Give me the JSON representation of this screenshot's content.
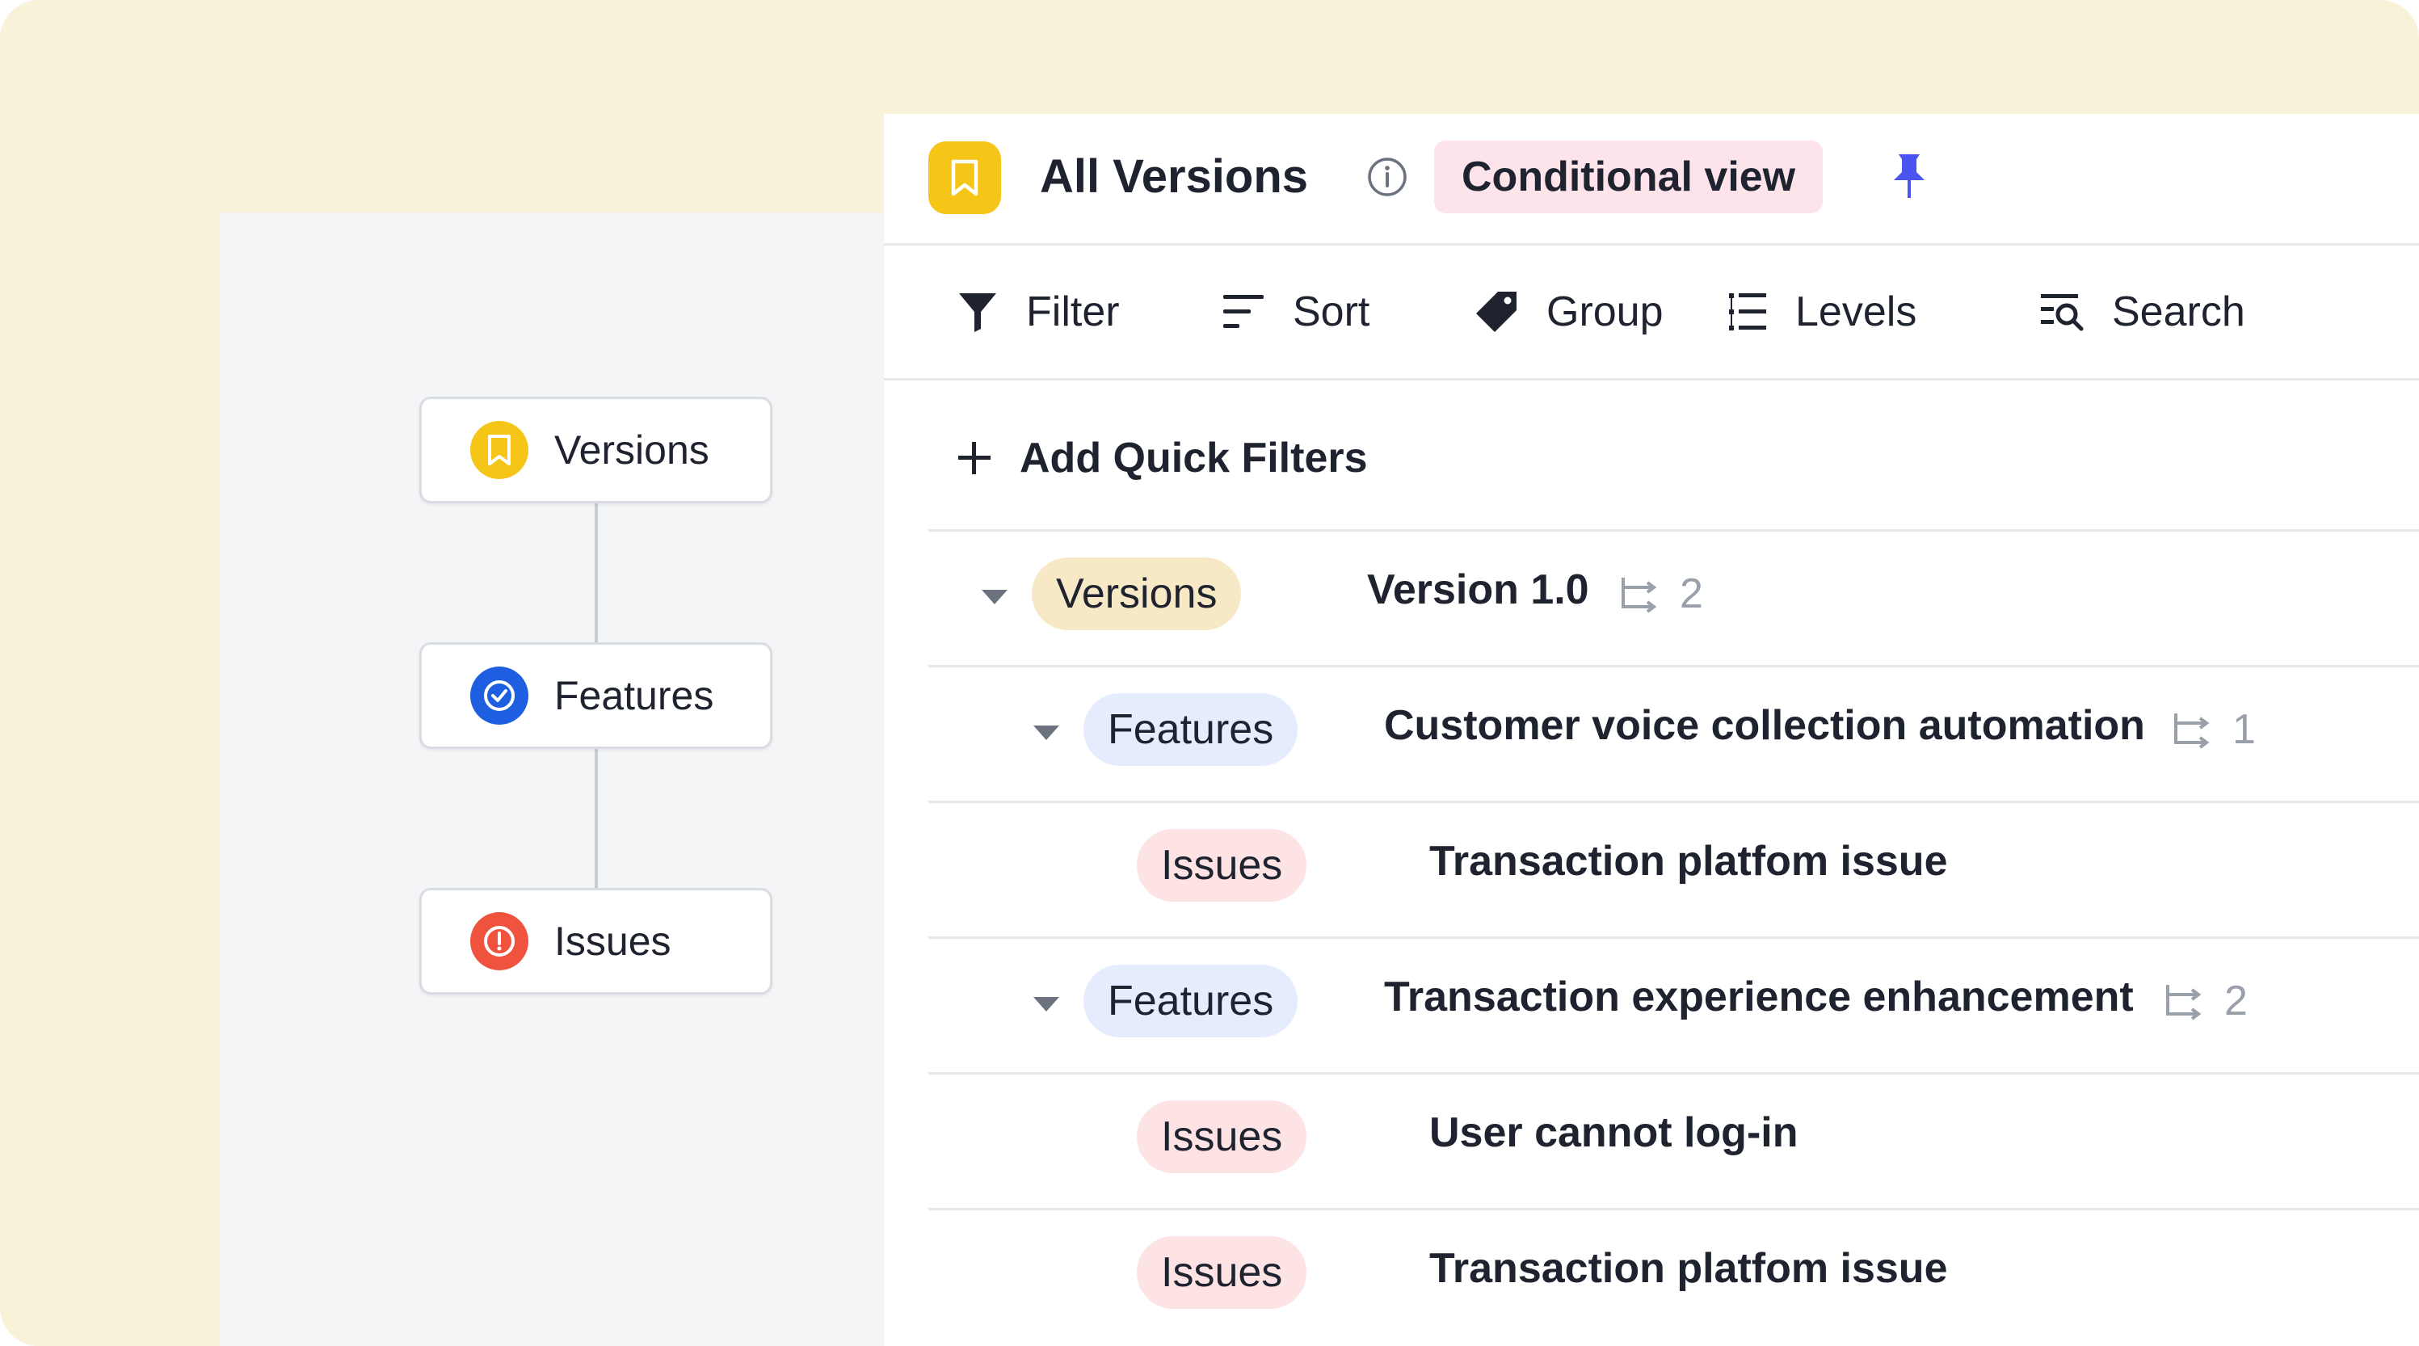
{
  "hierarchy": {
    "nodes": [
      {
        "label": "Versions",
        "icon": "bookmark-icon",
        "color": "#f5c518"
      },
      {
        "label": "Features",
        "icon": "check-circle-icon",
        "color": "#1d5fe0"
      },
      {
        "label": "Issues",
        "icon": "alert-circle-icon",
        "color": "#f0533d"
      }
    ]
  },
  "header": {
    "title": "All Versions",
    "badge": "Conditional view",
    "icons": [
      "bookmark-icon",
      "info-icon",
      "pin-icon"
    ],
    "accent": "#4b53f0"
  },
  "toolbar": {
    "filter": "Filter",
    "sort": "Sort",
    "group": "Group",
    "levels": "Levels",
    "search": "Search"
  },
  "quick_filters": {
    "label": "Add Quick Filters"
  },
  "rows": [
    {
      "type": "Versions",
      "title": "Version 1.0",
      "count": "2",
      "expanded": true
    },
    {
      "type": "Features",
      "title": "Customer voice collection automation",
      "count": "1",
      "expanded": true
    },
    {
      "type": "Issues",
      "title": "Transaction platfom issue"
    },
    {
      "type": "Features",
      "title": "Transaction experience enhancement",
      "count": "2",
      "expanded": true
    },
    {
      "type": "Issues",
      "title": "User cannot log-in"
    },
    {
      "type": "Issues",
      "title": "Transaction platfom issue"
    }
  ]
}
